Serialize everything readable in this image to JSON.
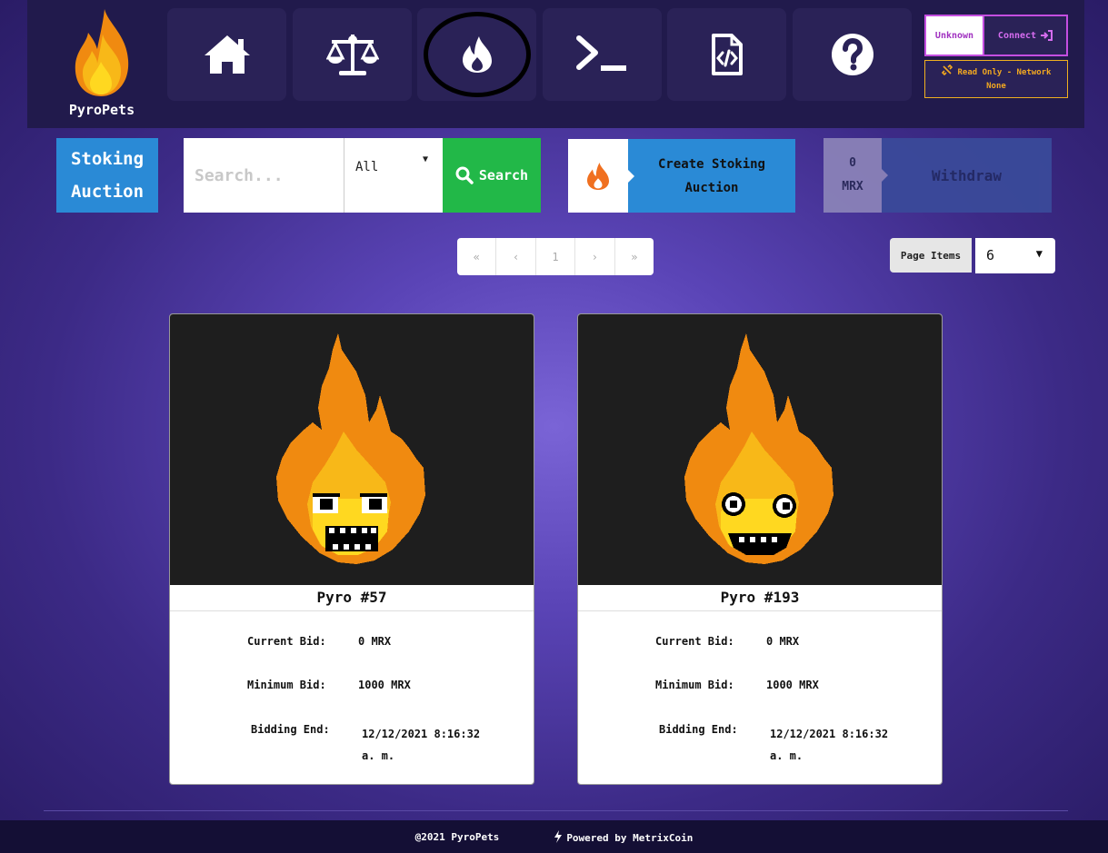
{
  "app": {
    "name": "PyroPets"
  },
  "nav": [
    {
      "name": "home-icon"
    },
    {
      "name": "scales-icon"
    },
    {
      "name": "fire-icon"
    },
    {
      "name": "terminal-icon"
    },
    {
      "name": "file-code-icon"
    },
    {
      "name": "question-icon"
    }
  ],
  "wallet": {
    "status": "Unknown",
    "connect_label": "Connect",
    "network_line1": "Read Only - Network",
    "network_line2": "None"
  },
  "toolbar": {
    "section_title_line1": "Stoking",
    "section_title_line2": "Auction",
    "search_placeholder": "Search...",
    "filter_value": "All",
    "search_label": "Search",
    "create_line1": "Create Stoking",
    "create_line2": "Auction",
    "balance_amount": "0",
    "balance_unit": "MRX",
    "withdraw_label": "Withdraw"
  },
  "pager": {
    "first": "«",
    "prev": "‹",
    "current": "1",
    "next": "›",
    "last": "»"
  },
  "page_items": {
    "label": "Page Items",
    "value": "6"
  },
  "labels": {
    "current_bid": "Current Bid:",
    "minimum_bid": "Minimum Bid:",
    "bidding_end": "Bidding End:"
  },
  "cards": [
    {
      "title": "Pyro #57",
      "current_bid": "0 MRX",
      "minimum_bid": "1000 MRX",
      "bidding_end_line1": "12/12/2021 8:16:32",
      "bidding_end_line2": "a. m."
    },
    {
      "title": "Pyro #193",
      "current_bid": "0 MRX",
      "minimum_bid": "1000 MRX",
      "bidding_end_line1": "12/12/2021 8:16:32",
      "bidding_end_line2": "a. m."
    }
  ],
  "footer": {
    "copyright": "@2021 PyroPets",
    "powered": "Powered by MetrixCoin"
  },
  "colors": {
    "accent_blue": "#2a8ad6",
    "search_green": "#22b848",
    "wallet_pink": "#c44ee0",
    "warning_orange": "#f2a820"
  }
}
